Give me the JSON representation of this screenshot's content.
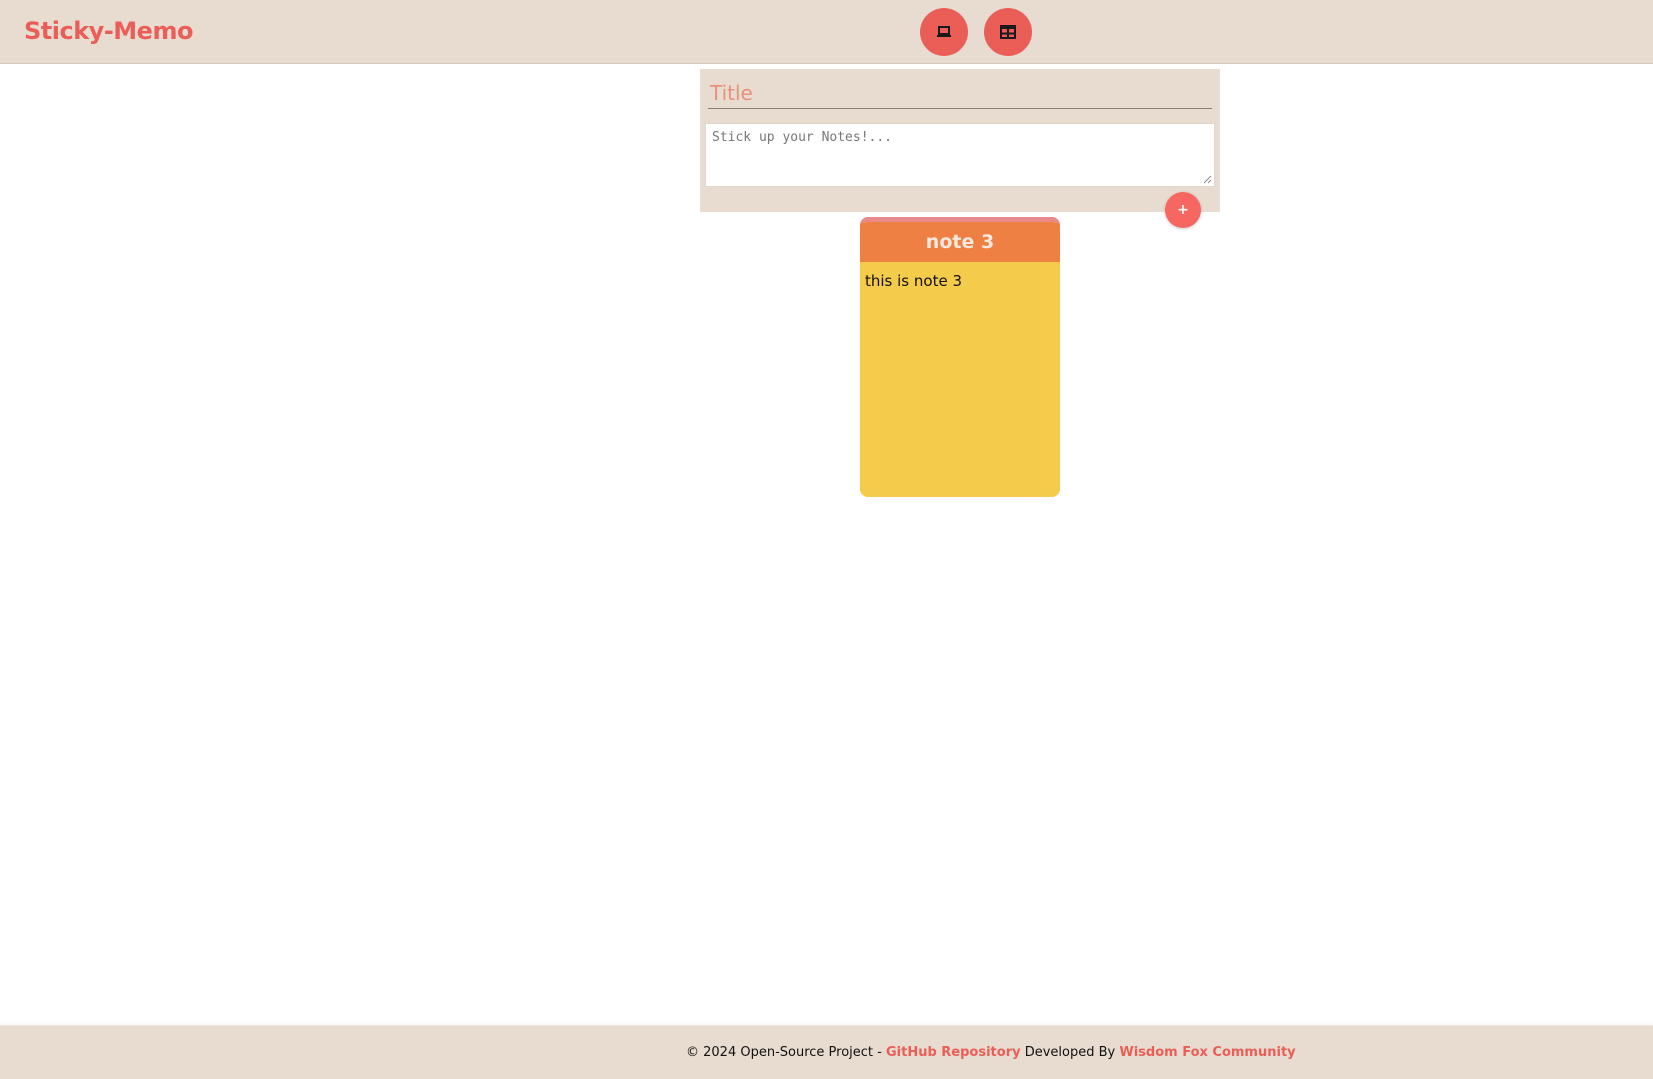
{
  "navbar": {
    "brand": "Sticky-Memo",
    "buttons": [
      {
        "icon": "laptop-icon"
      },
      {
        "icon": "table-grid-icon"
      }
    ]
  },
  "composer": {
    "title_placeholder": "Title",
    "note_placeholder": "Stick up your Notes!...",
    "add_label": "+"
  },
  "notes": [
    {
      "title": "note 3",
      "body": "this is note 3"
    }
  ],
  "footer": {
    "copyright": "© 2024 Open-Source Project - ",
    "repo_link": "GitHub Repository",
    "developed_by": " Developed By ",
    "community_link": "Wisdom Fox Community"
  },
  "colors": {
    "accent": "#ea5e57",
    "panel": "#e8dcd0",
    "note_header": "#ef8043",
    "note_body": "#f5cb4b"
  }
}
